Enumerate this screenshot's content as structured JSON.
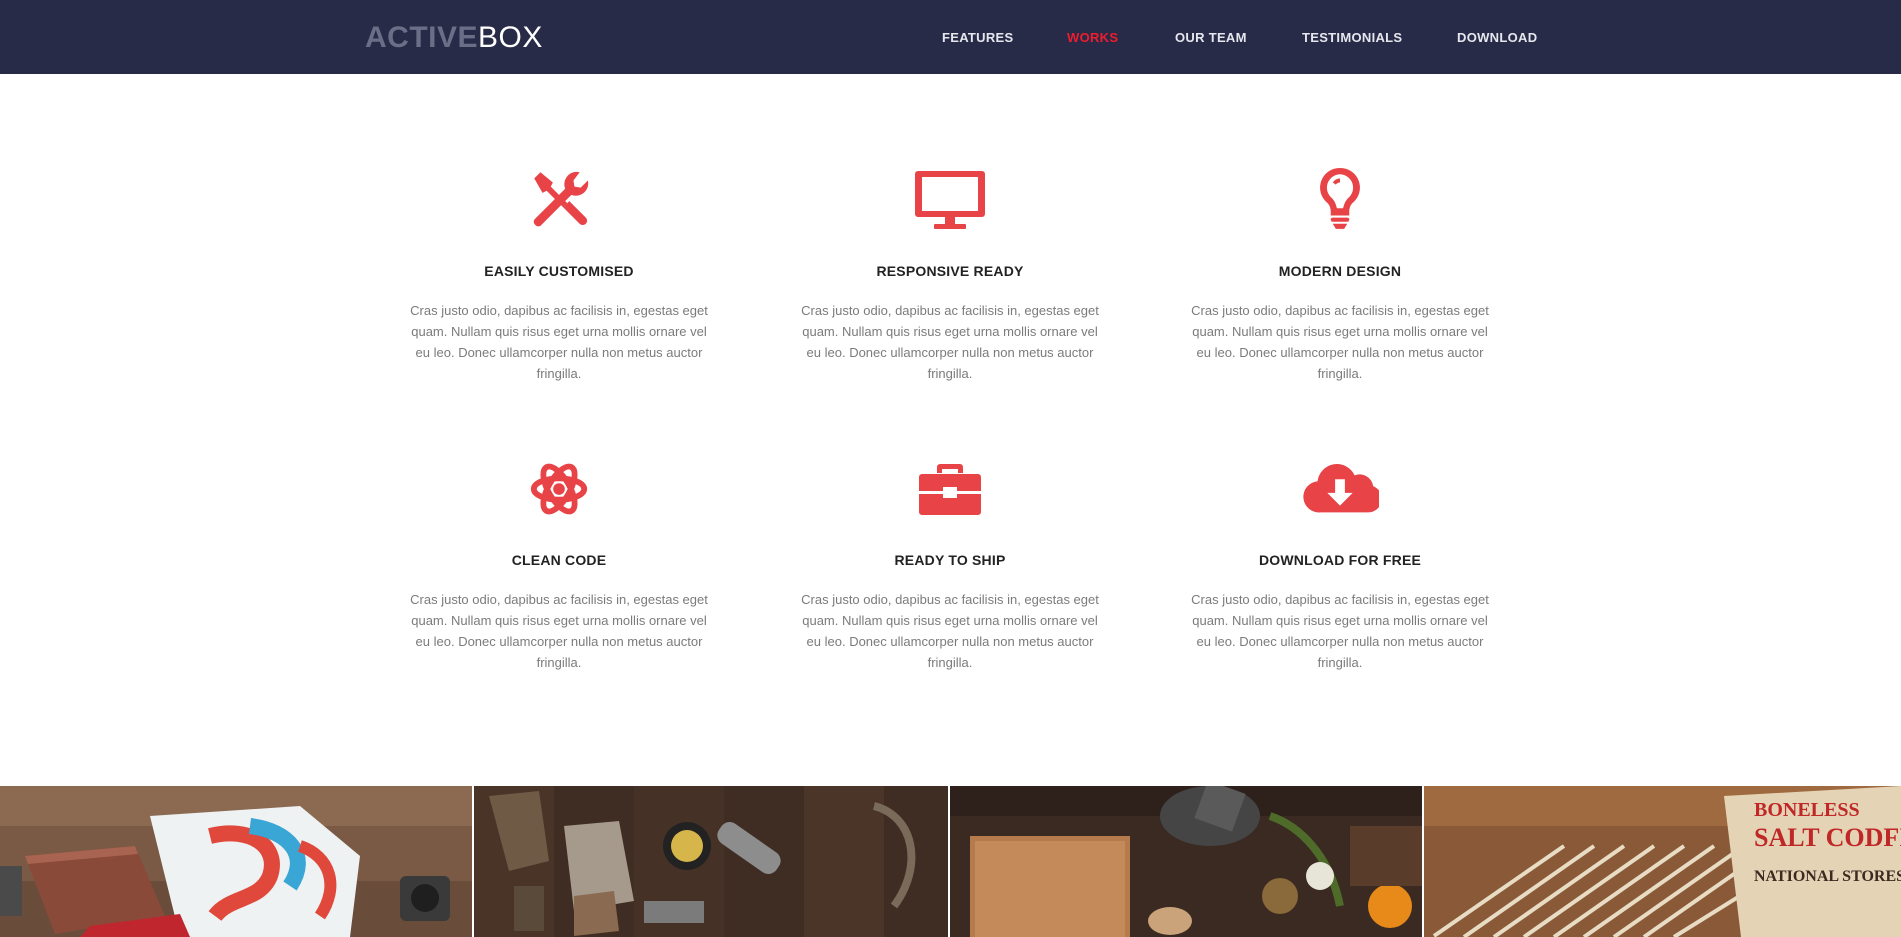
{
  "brand": {
    "logo_bold": "ACTIVE",
    "logo_light": "BOX"
  },
  "nav": {
    "items": [
      {
        "label": "FEATURES",
        "active": false
      },
      {
        "label": "WORKS",
        "active": true
      },
      {
        "label": "OUR TEAM",
        "active": false
      },
      {
        "label": "TESTIMONIALS",
        "active": false
      },
      {
        "label": "DOWNLOAD",
        "active": false
      }
    ]
  },
  "features": [
    {
      "icon": "tools-icon",
      "title": "EASILY CUSTOMISED",
      "desc": "Cras justo odio, dapibus ac facilisis in, egestas eget quam. Nullam quis risus eget urna mollis ornare vel eu leo. Donec ullamcorper nulla non metus auctor fringilla."
    },
    {
      "icon": "monitor-icon",
      "title": "RESPONSIVE READY",
      "desc": "Cras justo odio, dapibus ac facilisis in, egestas eget quam. Nullam quis risus eget urna mollis ornare vel eu leo. Donec ullamcorper nulla non metus auctor fringilla."
    },
    {
      "icon": "lightbulb-icon",
      "title": "MODERN DESIGN",
      "desc": "Cras justo odio, dapibus ac facilisis in, egestas eget quam. Nullam quis risus eget urna mollis ornare vel eu leo. Donec ullamcorper nulla non metus auctor fringilla."
    },
    {
      "icon": "atom-icon",
      "title": "CLEAN CODE",
      "desc": "Cras justo odio, dapibus ac facilisis in, egestas eget quam. Nullam quis risus eget urna mollis ornare vel eu leo. Donec ullamcorper nulla non metus auctor fringilla."
    },
    {
      "icon": "toolbox-icon",
      "title": "READY TO SHIP",
      "desc": "Cras justo odio, dapibus ac facilisis in, egestas eget quam. Nullam quis risus eget urna mollis ornare vel eu leo. Donec ullamcorper nulla non metus auctor fringilla."
    },
    {
      "icon": "cloud-download-icon",
      "title": "DOWNLOAD FOR FREE",
      "desc": "Cras justo odio, dapibus ac facilisis in, egestas eget quam. Nullam quis risus eget urna mollis ornare vel eu leo. Donec ullamcorper nulla non metus auctor fringilla."
    }
  ],
  "gallery": {
    "items": [
      {
        "name": "gallery-image-tshirt-book"
      },
      {
        "name": "gallery-image-vintage-tools"
      },
      {
        "name": "gallery-image-cooking-board"
      },
      {
        "name": "gallery-image-salt-codfish-crate",
        "sign_text": "BONELESS SALT CODFISH NATIONAL STORES"
      }
    ]
  },
  "colors": {
    "header_bg": "#282b48",
    "accent": "#e84347",
    "nav_active": "#ed1c2e",
    "nav_text": "#e6e7ee"
  }
}
